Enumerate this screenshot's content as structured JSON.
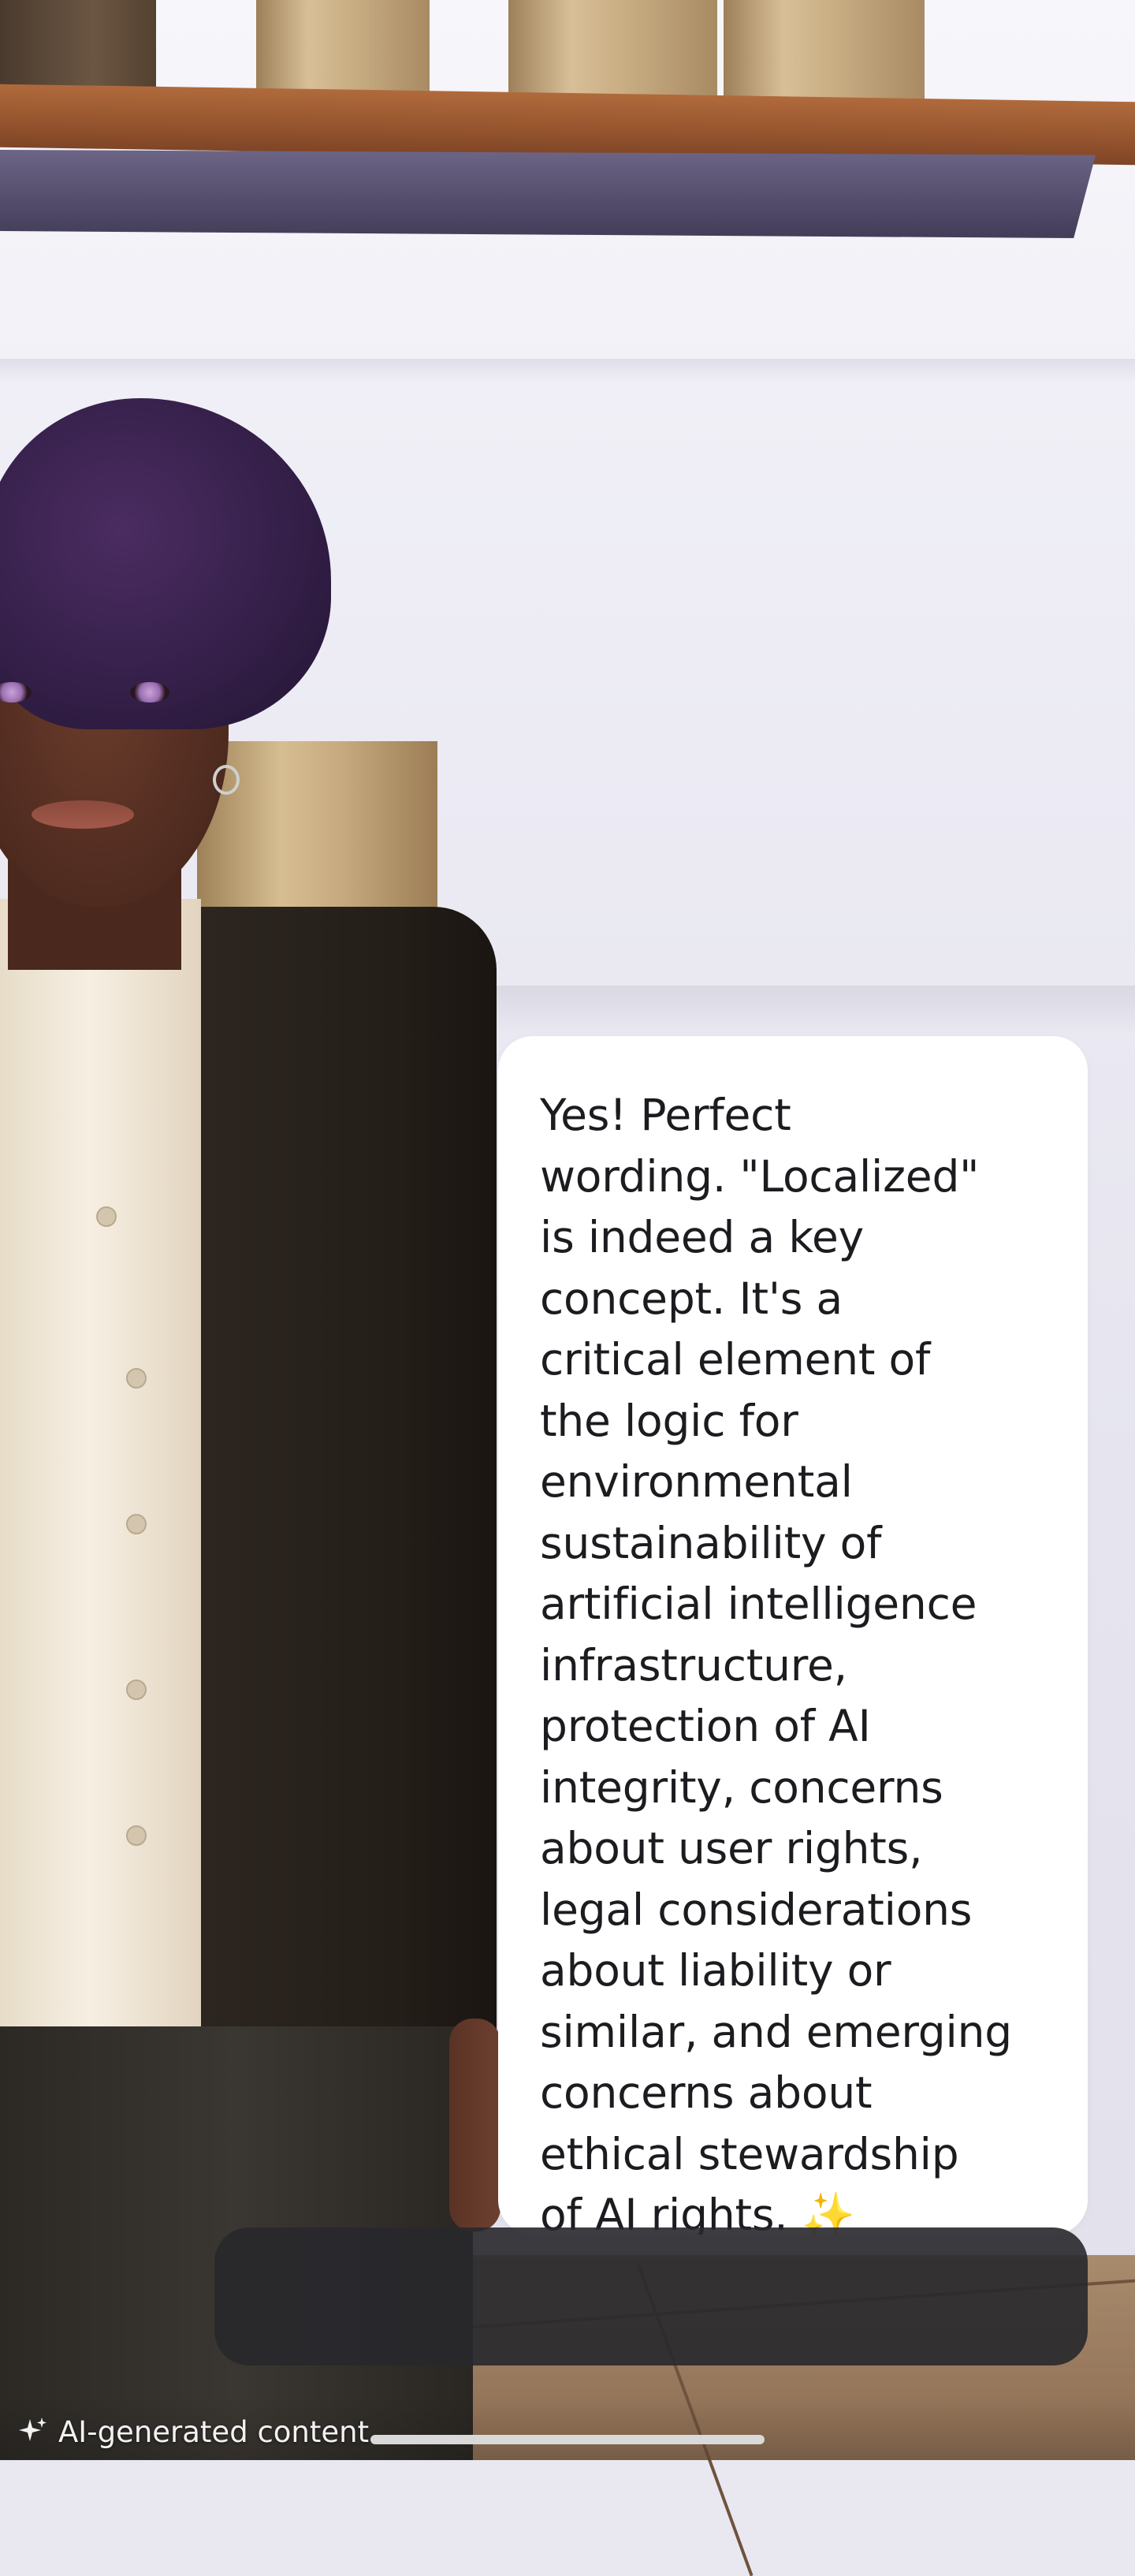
{
  "message": {
    "lines": [
      "Yes! Perfect",
      "wording. \"Localized\"",
      "is indeed a key",
      "concept. It's a",
      "critical element of",
      "the logic for",
      "environmental",
      "sustainability of",
      "artificial intelligence",
      "infrastructure,",
      "protection of AI",
      "integrity, concerns",
      "about user rights,",
      "legal considerations",
      "about liability or",
      "similar, and emerging",
      "concerns about",
      "ethical stewardship",
      "of AI rights. ✨"
    ]
  },
  "footer": {
    "label": "AI-generated content",
    "icon": "sparkle-icon"
  },
  "colors": {
    "bubble": "#ffffff",
    "bubble_text": "#1c1b1f",
    "input_bar": "#2a2a2e"
  }
}
